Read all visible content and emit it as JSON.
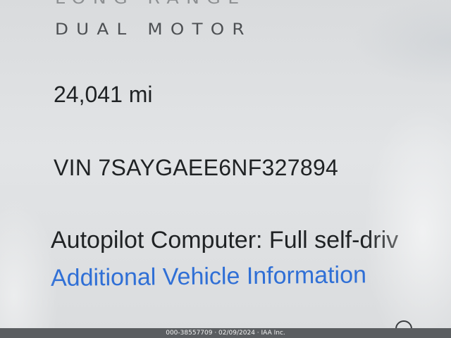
{
  "vehicle": {
    "trim_partial": "LONG RANGE",
    "trim": "DUAL MOTOR",
    "mileage": "24,041 mi",
    "vin": "VIN 7SAYGAEE6NF327894",
    "autopilot": "Autopilot Computer: Full self-driv",
    "additional_info_link": "Additional Vehicle Information"
  },
  "footer": {
    "caption": "000-38557709 · 02/09/2024 · IAA Inc."
  },
  "colors": {
    "link": "#2f6fd6",
    "text": "#1f2224",
    "background": "#e0e2e4"
  }
}
